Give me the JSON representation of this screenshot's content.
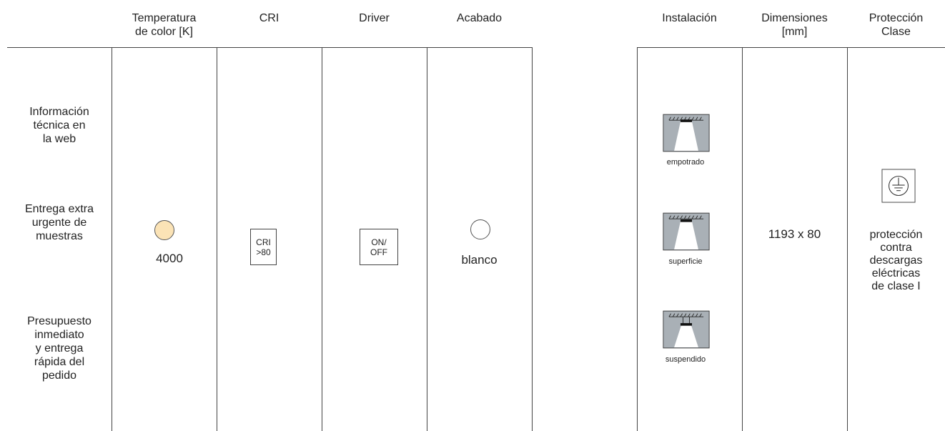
{
  "headers": {
    "temperature": [
      "Temperatura",
      "de color [K]"
    ],
    "cri": "CRI",
    "driver": "Driver",
    "finish": "Acabado",
    "installation": "Instalación",
    "dimensions": [
      "Dimensiones",
      "[mm]"
    ],
    "protection": [
      "Protección",
      "Clase"
    ]
  },
  "left_notes": {
    "web_info": [
      "Información",
      "técnica en",
      "la web"
    ],
    "urgent_samples": [
      "Entrega extra",
      "urgente de",
      "muestras"
    ],
    "quote": [
      "Presupuesto",
      "inmediato",
      "y entrega",
      "rápida del",
      "pedido"
    ]
  },
  "values": {
    "temperature": "4000",
    "temperature_swatch_color": "#FBE3B6",
    "cri_box": [
      "CRI",
      ">80"
    ],
    "driver_box": [
      "ON/",
      "OFF"
    ],
    "finish": "blanco",
    "finish_swatch_color": "#FFFFFF",
    "dimensions": "1193 x 80",
    "protection_icon": "earth-ground-icon",
    "protection_text": [
      "protección",
      "contra",
      "descargas",
      "eléctricas",
      "de clase I"
    ]
  },
  "installation": [
    {
      "label": "empotrado",
      "icon": "recessed-mount-icon"
    },
    {
      "label": "superficie",
      "icon": "surface-mount-icon"
    },
    {
      "label": "suspendido",
      "icon": "suspended-mount-icon"
    }
  ]
}
